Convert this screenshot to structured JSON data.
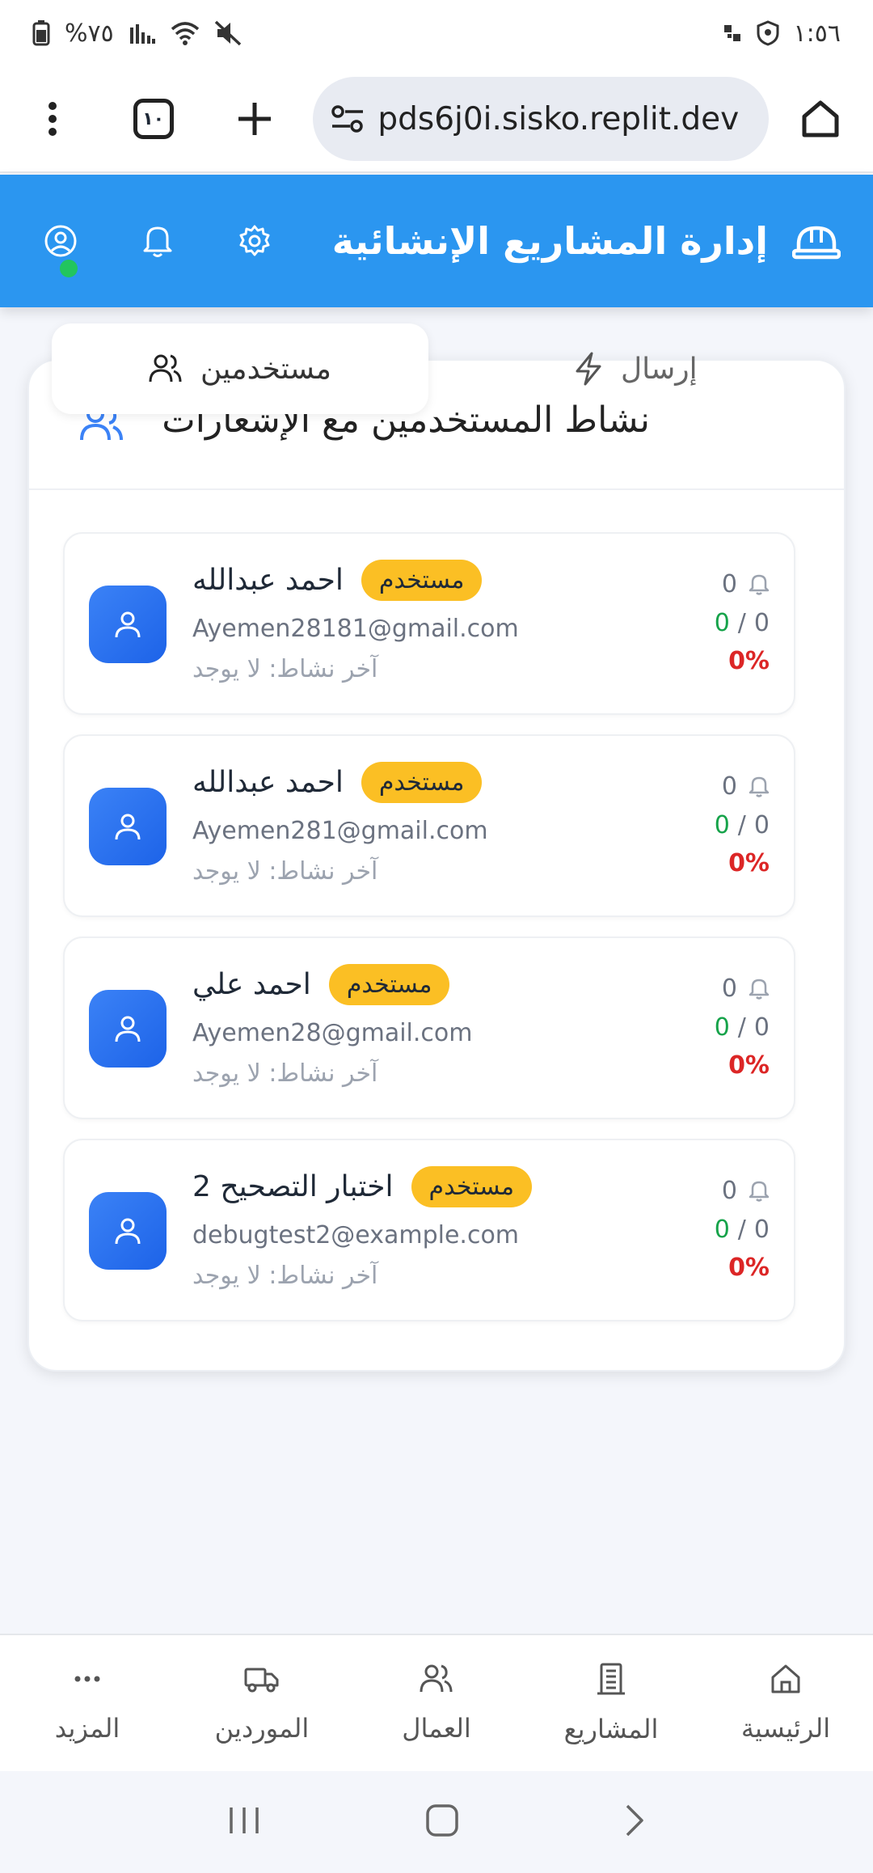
{
  "status_bar": {
    "time": "١:٥٦",
    "battery": "%٧٥"
  },
  "browser": {
    "url": "pds6j0i.sisko.replit.dev",
    "tab_count": "١٠"
  },
  "app_header": {
    "title": "إدارة المشاريع الإنشائية"
  },
  "card": {
    "title": "نشاط المستخدمين مع الإشعارات",
    "tabs": [
      {
        "label": "مستخدمين",
        "active": true
      },
      {
        "label": "إرسال",
        "active": false
      }
    ]
  },
  "users": [
    {
      "name": "احمد عبدالله",
      "role": "مستخدم",
      "email": "Ayemen28181@gmail.com",
      "last_activity": "آخر نشاط: لا يوجد",
      "notifications": "0",
      "done": "0",
      "total": "0",
      "separator": "/",
      "percent": "0%"
    },
    {
      "name": "احمد عبدالله",
      "role": "مستخدم",
      "email": "Ayemen281@gmail.com",
      "last_activity": "آخر نشاط: لا يوجد",
      "notifications": "0",
      "done": "0",
      "total": "0",
      "separator": "/",
      "percent": "0%"
    },
    {
      "name": "احمد علي",
      "role": "مستخدم",
      "email": "Ayemen28@gmail.com",
      "last_activity": "آخر نشاط: لا يوجد",
      "notifications": "0",
      "done": "0",
      "total": "0",
      "separator": "/",
      "percent": "0%"
    },
    {
      "name": "اختبار التصحيح 2",
      "role": "مستخدم",
      "email": "debugtest2@example.com",
      "last_activity": "آخر نشاط: لا يوجد",
      "notifications": "0",
      "done": "0",
      "total": "0",
      "separator": "/",
      "percent": "0%"
    }
  ],
  "bottom_nav": [
    {
      "label": "المزيد",
      "icon": "more-icon"
    },
    {
      "label": "الموردين",
      "icon": "truck-icon"
    },
    {
      "label": "العمال",
      "icon": "users-icon"
    },
    {
      "label": "المشاريع",
      "icon": "building-icon"
    },
    {
      "label": "الرئيسية",
      "icon": "home-icon"
    }
  ],
  "colors": {
    "header": "#2b96f0",
    "badge": "#fbbf24",
    "done": "#16a34a",
    "percent": "#dc2626",
    "avatar": "#2563eb",
    "online": "#22c55e"
  }
}
